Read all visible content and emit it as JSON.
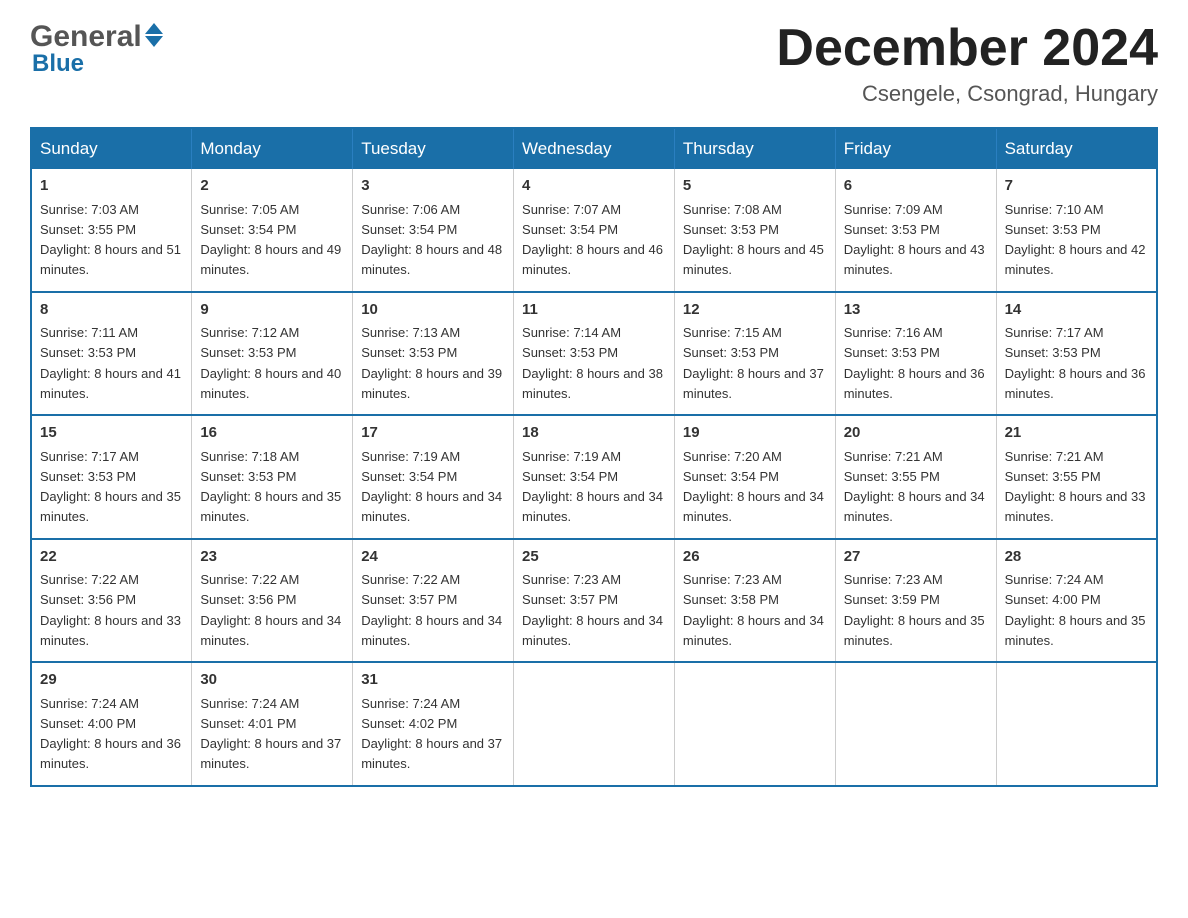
{
  "header": {
    "logo_general": "General",
    "logo_blue": "Blue",
    "month_title": "December 2024",
    "location": "Csengele, Csongrad, Hungary"
  },
  "weekdays": [
    "Sunday",
    "Monday",
    "Tuesday",
    "Wednesday",
    "Thursday",
    "Friday",
    "Saturday"
  ],
  "weeks": [
    [
      {
        "day": "1",
        "sunrise": "7:03 AM",
        "sunset": "3:55 PM",
        "daylight": "8 hours and 51 minutes."
      },
      {
        "day": "2",
        "sunrise": "7:05 AM",
        "sunset": "3:54 PM",
        "daylight": "8 hours and 49 minutes."
      },
      {
        "day": "3",
        "sunrise": "7:06 AM",
        "sunset": "3:54 PM",
        "daylight": "8 hours and 48 minutes."
      },
      {
        "day": "4",
        "sunrise": "7:07 AM",
        "sunset": "3:54 PM",
        "daylight": "8 hours and 46 minutes."
      },
      {
        "day": "5",
        "sunrise": "7:08 AM",
        "sunset": "3:53 PM",
        "daylight": "8 hours and 45 minutes."
      },
      {
        "day": "6",
        "sunrise": "7:09 AM",
        "sunset": "3:53 PM",
        "daylight": "8 hours and 43 minutes."
      },
      {
        "day": "7",
        "sunrise": "7:10 AM",
        "sunset": "3:53 PM",
        "daylight": "8 hours and 42 minutes."
      }
    ],
    [
      {
        "day": "8",
        "sunrise": "7:11 AM",
        "sunset": "3:53 PM",
        "daylight": "8 hours and 41 minutes."
      },
      {
        "day": "9",
        "sunrise": "7:12 AM",
        "sunset": "3:53 PM",
        "daylight": "8 hours and 40 minutes."
      },
      {
        "day": "10",
        "sunrise": "7:13 AM",
        "sunset": "3:53 PM",
        "daylight": "8 hours and 39 minutes."
      },
      {
        "day": "11",
        "sunrise": "7:14 AM",
        "sunset": "3:53 PM",
        "daylight": "8 hours and 38 minutes."
      },
      {
        "day": "12",
        "sunrise": "7:15 AM",
        "sunset": "3:53 PM",
        "daylight": "8 hours and 37 minutes."
      },
      {
        "day": "13",
        "sunrise": "7:16 AM",
        "sunset": "3:53 PM",
        "daylight": "8 hours and 36 minutes."
      },
      {
        "day": "14",
        "sunrise": "7:17 AM",
        "sunset": "3:53 PM",
        "daylight": "8 hours and 36 minutes."
      }
    ],
    [
      {
        "day": "15",
        "sunrise": "7:17 AM",
        "sunset": "3:53 PM",
        "daylight": "8 hours and 35 minutes."
      },
      {
        "day": "16",
        "sunrise": "7:18 AM",
        "sunset": "3:53 PM",
        "daylight": "8 hours and 35 minutes."
      },
      {
        "day": "17",
        "sunrise": "7:19 AM",
        "sunset": "3:54 PM",
        "daylight": "8 hours and 34 minutes."
      },
      {
        "day": "18",
        "sunrise": "7:19 AM",
        "sunset": "3:54 PM",
        "daylight": "8 hours and 34 minutes."
      },
      {
        "day": "19",
        "sunrise": "7:20 AM",
        "sunset": "3:54 PM",
        "daylight": "8 hours and 34 minutes."
      },
      {
        "day": "20",
        "sunrise": "7:21 AM",
        "sunset": "3:55 PM",
        "daylight": "8 hours and 34 minutes."
      },
      {
        "day": "21",
        "sunrise": "7:21 AM",
        "sunset": "3:55 PM",
        "daylight": "8 hours and 33 minutes."
      }
    ],
    [
      {
        "day": "22",
        "sunrise": "7:22 AM",
        "sunset": "3:56 PM",
        "daylight": "8 hours and 33 minutes."
      },
      {
        "day": "23",
        "sunrise": "7:22 AM",
        "sunset": "3:56 PM",
        "daylight": "8 hours and 34 minutes."
      },
      {
        "day": "24",
        "sunrise": "7:22 AM",
        "sunset": "3:57 PM",
        "daylight": "8 hours and 34 minutes."
      },
      {
        "day": "25",
        "sunrise": "7:23 AM",
        "sunset": "3:57 PM",
        "daylight": "8 hours and 34 minutes."
      },
      {
        "day": "26",
        "sunrise": "7:23 AM",
        "sunset": "3:58 PM",
        "daylight": "8 hours and 34 minutes."
      },
      {
        "day": "27",
        "sunrise": "7:23 AM",
        "sunset": "3:59 PM",
        "daylight": "8 hours and 35 minutes."
      },
      {
        "day": "28",
        "sunrise": "7:24 AM",
        "sunset": "4:00 PM",
        "daylight": "8 hours and 35 minutes."
      }
    ],
    [
      {
        "day": "29",
        "sunrise": "7:24 AM",
        "sunset": "4:00 PM",
        "daylight": "8 hours and 36 minutes."
      },
      {
        "day": "30",
        "sunrise": "7:24 AM",
        "sunset": "4:01 PM",
        "daylight": "8 hours and 37 minutes."
      },
      {
        "day": "31",
        "sunrise": "7:24 AM",
        "sunset": "4:02 PM",
        "daylight": "8 hours and 37 minutes."
      },
      null,
      null,
      null,
      null
    ]
  ],
  "labels": {
    "sunrise": "Sunrise:",
    "sunset": "Sunset:",
    "daylight": "Daylight:"
  }
}
